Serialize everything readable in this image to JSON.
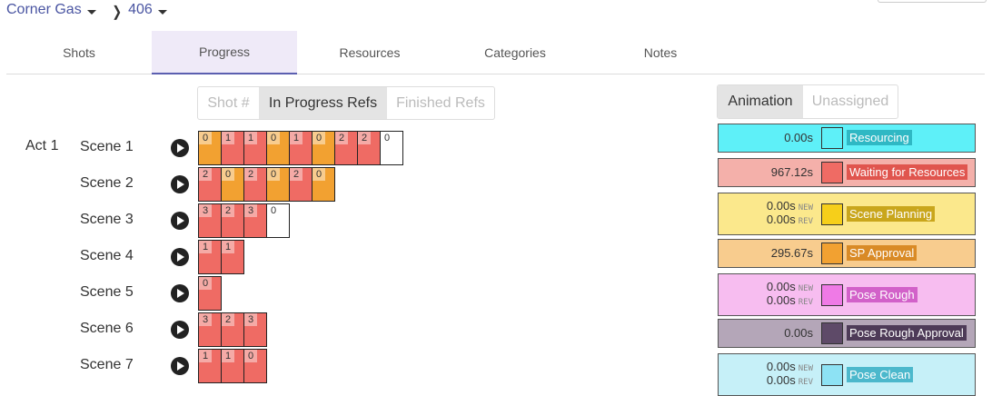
{
  "breadcrumb": {
    "project": "Corner Gas",
    "episode": "406"
  },
  "tabs": [
    {
      "label": "Shots"
    },
    {
      "label": "Progress"
    },
    {
      "label": "Resources"
    },
    {
      "label": "Categories"
    },
    {
      "label": "Notes"
    }
  ],
  "active_tab": "Progress",
  "filter": {
    "shot": "Shot #",
    "in_progress": "In Progress Refs",
    "finished": "Finished Refs",
    "selected": "In Progress Refs"
  },
  "department": {
    "animation": "Animation",
    "unassigned": "Unassigned",
    "selected": "Animation"
  },
  "act_label": "Act 1",
  "scenes": [
    {
      "label": "Scene 1",
      "cells": [
        {
          "n": "0",
          "c": "orange"
        },
        {
          "n": "1",
          "c": "red"
        },
        {
          "n": "1",
          "c": "red"
        },
        {
          "n": "0",
          "c": "orange"
        },
        {
          "n": "1",
          "c": "red"
        },
        {
          "n": "0",
          "c": "orange"
        },
        {
          "n": "2",
          "c": "red"
        },
        {
          "n": "2",
          "c": "red"
        },
        {
          "n": "0",
          "c": "white"
        }
      ]
    },
    {
      "label": "Scene 2",
      "cells": [
        {
          "n": "2",
          "c": "red"
        },
        {
          "n": "0",
          "c": "orange"
        },
        {
          "n": "2",
          "c": "red"
        },
        {
          "n": "0",
          "c": "orange"
        },
        {
          "n": "2",
          "c": "red"
        },
        {
          "n": "0",
          "c": "orange"
        }
      ]
    },
    {
      "label": "Scene 3",
      "cells": [
        {
          "n": "3",
          "c": "red"
        },
        {
          "n": "2",
          "c": "red"
        },
        {
          "n": "3",
          "c": "red"
        },
        {
          "n": "0",
          "c": "white"
        }
      ]
    },
    {
      "label": "Scene 4",
      "cells": [
        {
          "n": "1",
          "c": "red"
        },
        {
          "n": "1",
          "c": "red"
        }
      ]
    },
    {
      "label": "Scene 5",
      "cells": [
        {
          "n": "0",
          "c": "red"
        }
      ]
    },
    {
      "label": "Scene 6",
      "cells": [
        {
          "n": "3",
          "c": "red"
        },
        {
          "n": "2",
          "c": "red"
        },
        {
          "n": "3",
          "c": "red"
        }
      ]
    },
    {
      "label": "Scene 7",
      "cells": [
        {
          "n": "1",
          "c": "red"
        },
        {
          "n": "1",
          "c": "red"
        },
        {
          "n": "0",
          "c": "red"
        }
      ]
    }
  ],
  "statuses": [
    {
      "label": "Resourcing",
      "bg": "#5ef0f8",
      "swatch": "#5ef0f8",
      "labelbg": "#2fb8c4",
      "time": "0.00s"
    },
    {
      "label": "Waiting for Resources",
      "bg": "#f4b0aa",
      "swatch": "#ef6b64",
      "labelbg": "#e0554e",
      "time": "967.12s"
    },
    {
      "label": "Scene Planning",
      "bg": "#fbe88c",
      "swatch": "#f6cf1a",
      "labelbg": "#c9a61c",
      "time_new": "0.00s",
      "time_rev": "0.00s",
      "new": "NEW",
      "rev": "REV"
    },
    {
      "label": "SP Approval",
      "bg": "#f8cc8e",
      "swatch": "#f2a131",
      "labelbg": "#d98a26",
      "time": "295.67s"
    },
    {
      "label": "Pose Rough",
      "bg": "#f7bdf0",
      "swatch": "#ef7ae6",
      "labelbg": "#d261c9",
      "time_new": "0.00s",
      "time_rev": "0.00s",
      "new": "NEW",
      "rev": "REV"
    },
    {
      "label": "Pose Rough Approval",
      "bg": "#b4a6b8",
      "swatch": "#5e4a68",
      "labelbg": "#4e3b58",
      "time": "0.00s"
    },
    {
      "label": "Pose Clean",
      "bg": "#c6f0f8",
      "swatch": "#8de2f4",
      "labelbg": "#4cb8cc",
      "time_new": "0.00s",
      "time_rev": "0.00s",
      "new": "NEW",
      "rev": "REV"
    }
  ]
}
